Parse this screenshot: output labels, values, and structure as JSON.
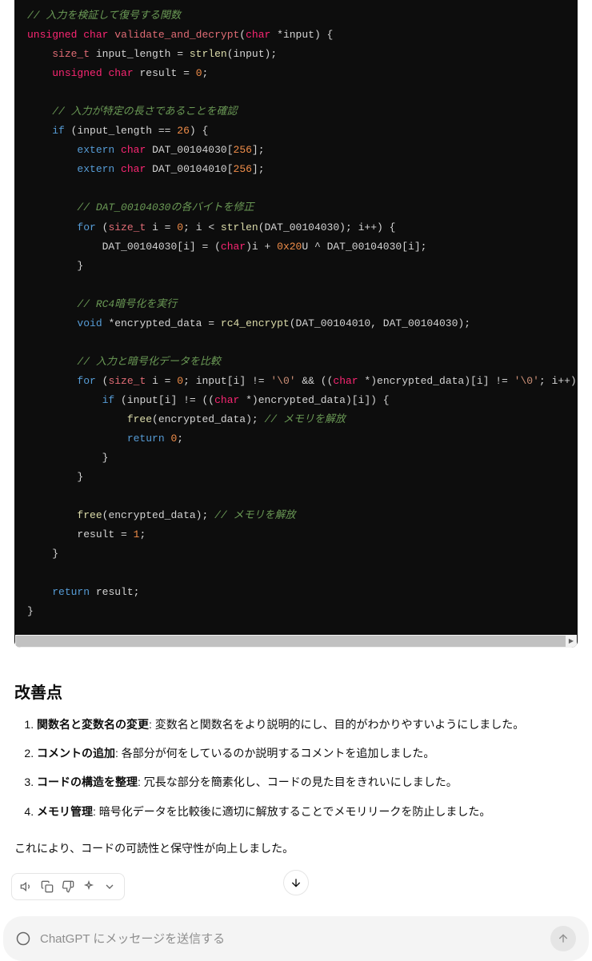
{
  "code": {
    "comment_validate": "// 入力を検証して復号する関数",
    "kw_unsigned1": "unsigned",
    "kw_char1": "char",
    "func_name": "validate_and_decrypt",
    "kw_char2": "char",
    "param_input": "*input",
    "kw_size_t1": "size_t",
    "var_input_length": "input_length",
    "func_strlen1": "strlen",
    "arg_input1": "input",
    "kw_unsigned2": "unsigned",
    "kw_char3": "char",
    "var_result": "result",
    "num_0a": "0",
    "comment_length": "// 入力が特定の長さであることを確認",
    "kw_if1": "if",
    "var_input_length2": "input_length",
    "num_26": "26",
    "kw_extern1": "extern",
    "kw_char4": "char",
    "dat_30a": "DAT_00104030",
    "num_256a": "256",
    "kw_extern2": "extern",
    "kw_char5": "char",
    "dat_10a": "DAT_00104010",
    "num_256b": "256",
    "comment_modify": "// DAT_00104030の各バイトを修正",
    "kw_for1": "for",
    "kw_size_t2": "size_t",
    "var_i1": "i",
    "num_0b": "0",
    "var_i2": "i",
    "func_strlen2": "strlen",
    "dat_30b": "DAT_00104030",
    "var_i3": "i",
    "dat_30c": "DAT_00104030",
    "var_i4": "i",
    "kw_char6": "char",
    "var_i5": "i",
    "num_0x20": "0x20",
    "suffix_u": "U",
    "dat_30d": "DAT_00104030",
    "var_i6": "i",
    "comment_rc4": "// RC4暗号化を実行",
    "kw_void": "void",
    "var_encrypted": "*encrypted_data",
    "func_rc4": "rc4_encrypt",
    "dat_10b": "DAT_00104010",
    "dat_30e": "DAT_00104030",
    "comment_compare": "// 入力と暗号化データを比較",
    "kw_for2": "for",
    "kw_size_t3": "size_t",
    "var_i7": "i",
    "num_0c": "0",
    "var_input2": "input",
    "var_i8": "i",
    "str_null1": "'\\0'",
    "kw_char7": "char",
    "var_encrypted2": "encrypted_data",
    "var_i9": "i",
    "str_null2": "'\\0'",
    "var_i10": "i",
    "kw_if2": "if",
    "var_input3": "input",
    "var_i11": "i",
    "kw_char8": "char",
    "var_encrypted3": "encrypted_data",
    "var_i12": "i",
    "func_free1": "free",
    "var_encrypted4": "encrypted_data",
    "comment_free1": "// メモリを解放",
    "kw_return1": "return",
    "num_0d": "0",
    "func_free2": "free",
    "var_encrypted5": "encrypted_data",
    "comment_free2": "// メモリを解放",
    "var_result2": "result",
    "num_1": "1",
    "kw_return2": "return",
    "var_result3": "result"
  },
  "content": {
    "heading": "改善点",
    "items": [
      {
        "bold": "関数名と変数名の変更",
        "text": ": 変数名と関数名をより説明的にし、目的がわかりやすいようにしました。"
      },
      {
        "bold": "コメントの追加",
        "text": ": 各部分が何をしているのか説明するコメントを追加しました。"
      },
      {
        "bold": "コードの構造を整理",
        "text": ": 冗長な部分を簡素化し、コードの見た目をきれいにしました。"
      },
      {
        "bold": "メモリ管理",
        "text": ": 暗号化データを比較後に適切に解放することでメモリリークを防止しました。"
      }
    ],
    "closing": "これにより、コードの可読性と保守性が向上しました。"
  },
  "input": {
    "placeholder": "ChatGPT にメッセージを送信する"
  }
}
